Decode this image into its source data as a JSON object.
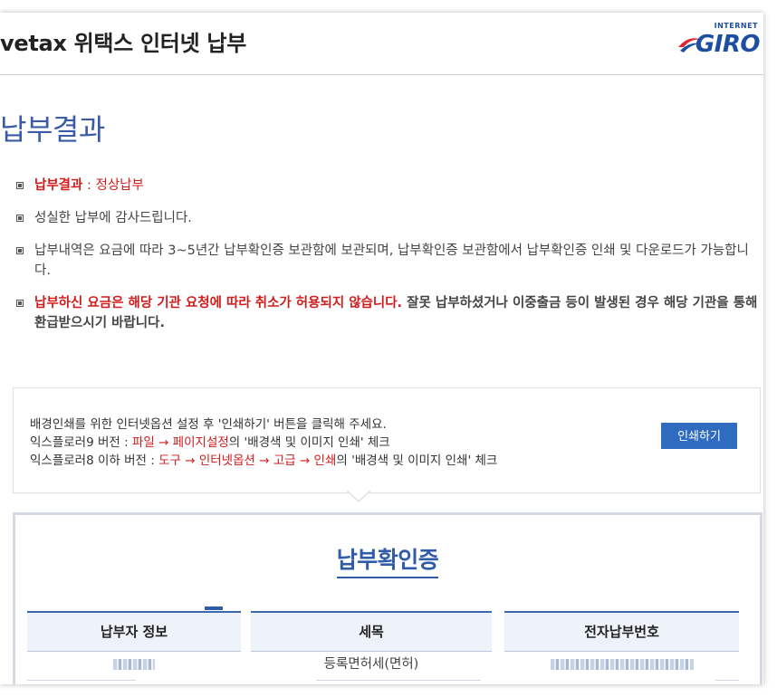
{
  "header": {
    "title": "vetax 위택스 인터넷 납부",
    "logo_small": "INTERNET",
    "logo_big": "GIRO",
    "logo_icon": "giro-swoosh-logo"
  },
  "page_title": "납부결과",
  "notes": {
    "result_label": "납부결과",
    "result_value": " : 정상납부",
    "thanks": "성실한 납부에 감사드립니다.",
    "storage": "납부내역은 요금에 따라 3~5년간 납부확인증 보관함에 보관되며, 납부확인증 보관함에서 납부확인증 인쇄 및 다운로드가 가능합니다.",
    "cancel_red": "납부하신 요금은 해당 기관 요청에 따라 취소가 허용되지 않습니다.",
    "cancel_rest": " 잘못 납부하셨거나 이중출금 등이 발생된 경우 해당 기관을 통해 환급받으시기 바랍니다."
  },
  "print_box": {
    "line1": "배경인쇄를 위한 인터넷옵션 설정 후 '인쇄하기' 버튼을 클릭해 주세요.",
    "ie9_prefix": "익스플로러9 버전 : ",
    "ie9_path": "파일 → 페이지설정",
    "ie9_suffix": "의 '배경색 및 이미지 인쇄' 체크",
    "ie8_prefix": "익스플로러8 이하 버전 : ",
    "ie8_path": "도구 → 인터넷옵션 → 고급 → 인쇄",
    "ie8_suffix": "의 '배경색 및 이미지 인쇄' 체크",
    "button": "인쇄하기"
  },
  "certificate": {
    "title": "납부확인증",
    "columns": [
      "납부자 정보",
      "세목",
      "전자납부번호"
    ],
    "row": {
      "tax_item": "등록면허세(면허)"
    }
  },
  "colors": {
    "accent_blue": "#2f5ba8",
    "button_blue": "#2f6bbf",
    "warning_red": "#d11c1c"
  }
}
